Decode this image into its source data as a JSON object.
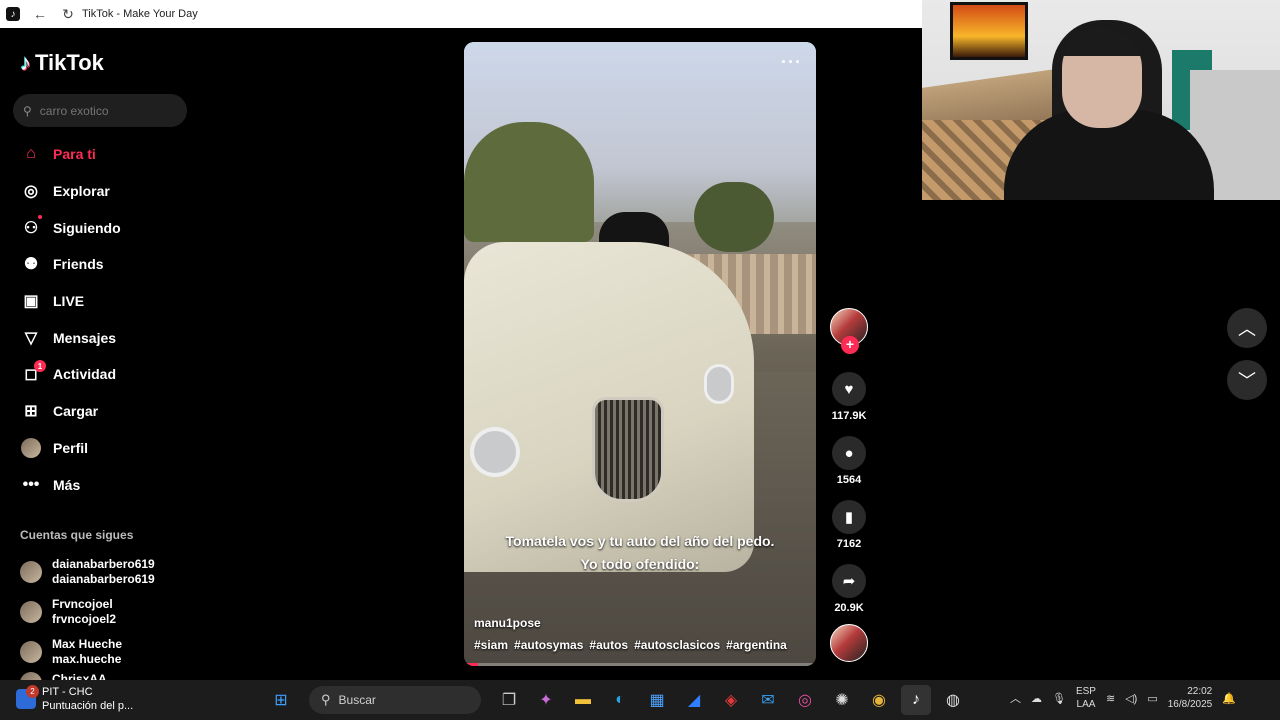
{
  "window": {
    "title": "TikTok - Make Your Day"
  },
  "sidebar": {
    "brand": "TikTok",
    "search_placeholder": "carro exotico",
    "items": [
      {
        "label": "Para ti",
        "icon": "home-icon",
        "glyph": "⌂",
        "active": true
      },
      {
        "label": "Explorar",
        "icon": "compass-icon",
        "glyph": "◎"
      },
      {
        "label": "Siguiendo",
        "icon": "following-icon",
        "glyph": "⚇"
      },
      {
        "label": "Friends",
        "icon": "friends-icon",
        "glyph": "⚉"
      },
      {
        "label": "LIVE",
        "icon": "live-icon",
        "glyph": "▣"
      },
      {
        "label": "Mensajes",
        "icon": "message-icon",
        "glyph": "▽"
      },
      {
        "label": "Actividad",
        "icon": "activity-icon",
        "glyph": "◻",
        "badge": "1"
      },
      {
        "label": "Cargar",
        "icon": "upload-icon",
        "glyph": "⊞"
      },
      {
        "label": "Perfil",
        "icon": "profile-icon",
        "glyph": "●"
      },
      {
        "label": "Más",
        "icon": "more-icon",
        "glyph": "•••"
      }
    ],
    "following_title": "Cuentas que sigues",
    "following": [
      {
        "name": "daianabarbero619",
        "handle": "daianabarbero619"
      },
      {
        "name": "Frvncojoel",
        "handle": "frvncojoel2"
      },
      {
        "name": "Max Hueche",
        "handle": "max.hueche"
      },
      {
        "name": "ChrisxAA",
        "handle": ""
      }
    ]
  },
  "video": {
    "caption_line1": "Tomatela vos y tu auto del año del pedo.",
    "caption_line2": "Yo todo ofendido:",
    "author": "manu1pose",
    "tags": [
      "#siam",
      "#autosymas",
      "#autos",
      "#autosclasicos",
      "#argentina"
    ],
    "progress": 0.04
  },
  "actions": {
    "likes": "117.9K",
    "comments": "1564",
    "saves": "7162",
    "shares": "20.9K"
  },
  "taskbar": {
    "widget_title": "PIT - CHC",
    "widget_sub": "Puntuación del p...",
    "widget_badge": "2",
    "search_label": "Buscar",
    "lang_top": "ESP",
    "lang_bottom": "LAA",
    "time": "22:02",
    "date": "16/8/2025"
  },
  "colors": {
    "accent": "#fe2c55",
    "background": "#000000"
  }
}
